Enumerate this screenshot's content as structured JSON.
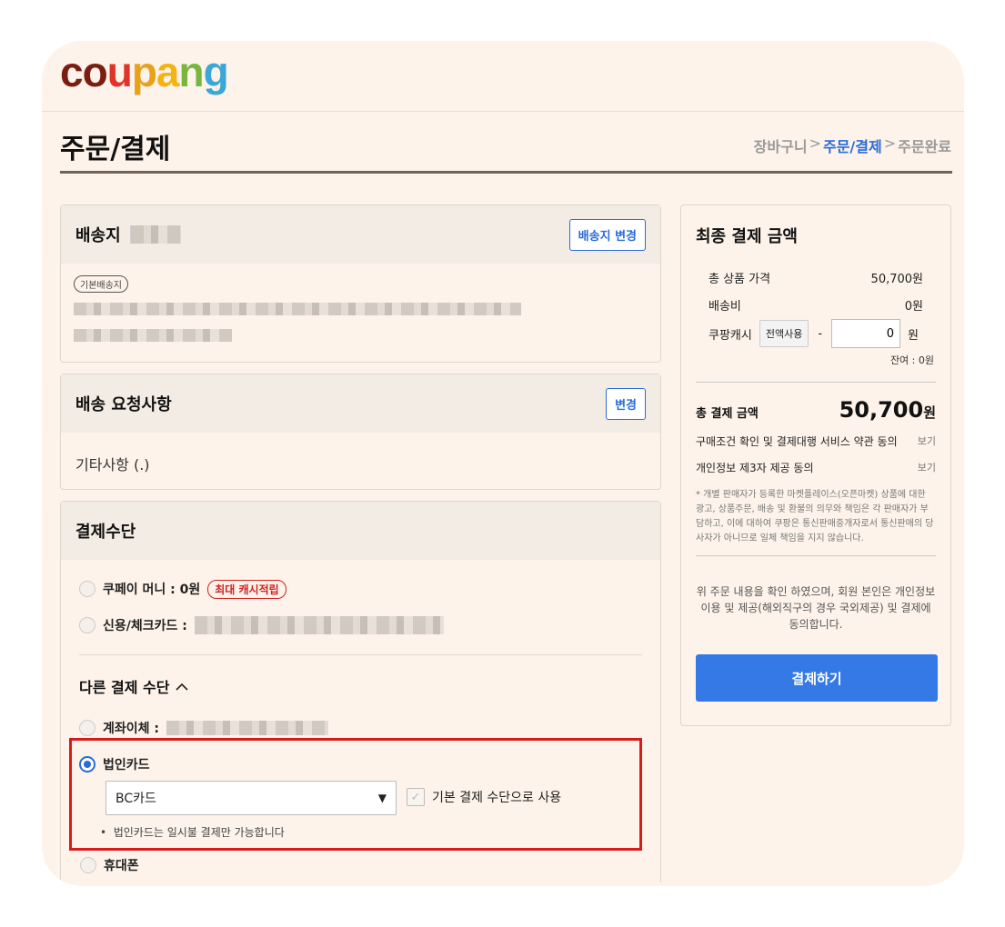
{
  "logo": {
    "parts": [
      "c",
      "o",
      "u",
      "p",
      "a",
      "n",
      "g"
    ]
  },
  "page": {
    "title": "주문/결제"
  },
  "breadcrumb": {
    "step1": "장바구니",
    "step2": "주문/결제",
    "step3": "주문완료",
    "separator": ">"
  },
  "address": {
    "title": "배송지",
    "change_button": "배송지 변경",
    "tag": "기본배송지"
  },
  "request": {
    "title": "배송 요청사항",
    "change_button": "변경",
    "value": "기타사항 (.)"
  },
  "payment": {
    "title": "결제수단",
    "coupay_label": "쿠페이 머니 : 0원",
    "coupay_badge": "최대 캐시적립",
    "card_label": "신용/체크카드 :",
    "other_title": "다른 결제 수단",
    "bank_label": "계좌이체 :",
    "corp_card_label": "법인카드",
    "corp_card_select": "BC카드",
    "default_checkbox_label": "기본 결제 수단으로 사용",
    "corp_card_note": "법인카드는 일시불 결제만 가능합니다",
    "phone_label": "휴대폰"
  },
  "summary": {
    "title": "최종 결제 금액",
    "product_price_label": "총 상품 가격",
    "product_price_value": "50,700원",
    "shipping_label": "배송비",
    "shipping_value": "0원",
    "cash_label": "쿠팡캐시",
    "cash_use_all_button": "전액사용",
    "cash_minus": "-",
    "cash_input_value": "0",
    "cash_unit": "원",
    "remaining": "잔여 : 0원",
    "total_label": "총 결제 금액",
    "total_value": "50,700",
    "total_unit": "원",
    "agree1": "구매조건 확인 및 결제대행 서비스 약관 동의",
    "agree1_link": "보기",
    "agree2": "개인정보 제3자 제공 동의",
    "agree2_link": "보기",
    "disclaimer": "* 개별 판매자가 등록한 마켓플레이스(오픈마켓) 상품에 대한 광고, 상품주문, 배송 및 환불의 의무와 책임은 각 판매자가 부담하고, 이에 대하여 쿠팡은 통신판매중개자로서 통신판매의 당사자가 아니므로 일체 책임을 지지 않습니다.",
    "confirm_text": "위 주문 내용을 확인 하였으며, 회원 본인은 개인정보 이용 및 제공(해외직구의 경우 국외제공) 및 결제에 동의합니다.",
    "pay_button": "결제하기"
  },
  "colors": {
    "accent": "#2a6bd8",
    "pay_button": "#3579e6",
    "highlight_box": "#d91a1a",
    "background": "#fdf3ea"
  }
}
